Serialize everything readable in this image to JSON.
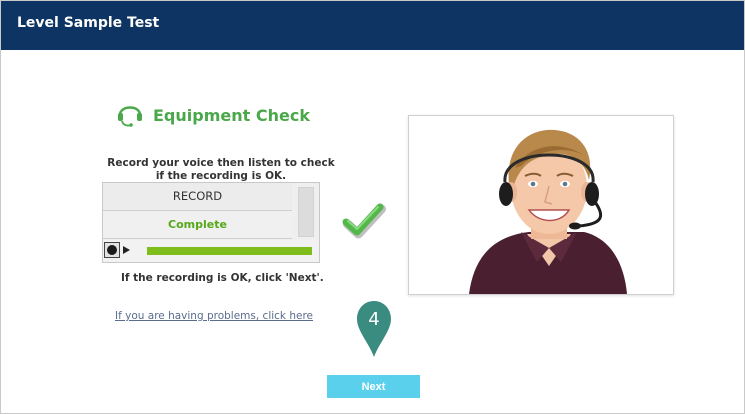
{
  "header": {
    "title": "Level Sample Test"
  },
  "equipment_check": {
    "title": "Equipment Check",
    "icon": "headset-icon",
    "instruction_line1": "Record your voice then listen to check",
    "instruction_line2": "if the recording is OK.",
    "record_label": "RECORD",
    "status_text": "Complete",
    "playback_progress": 1.0,
    "ok_text": "If the recording is OK, click 'Next'.",
    "help_link": "If you are having problems, click here"
  },
  "step_marker": {
    "number": "4",
    "color": "#3a8c80"
  },
  "next_button": {
    "label": "Next"
  },
  "colors": {
    "header_bg": "#0d3462",
    "accent_green": "#4aa84a",
    "status_green": "#56a818",
    "next_button": "#5bd0ec"
  }
}
